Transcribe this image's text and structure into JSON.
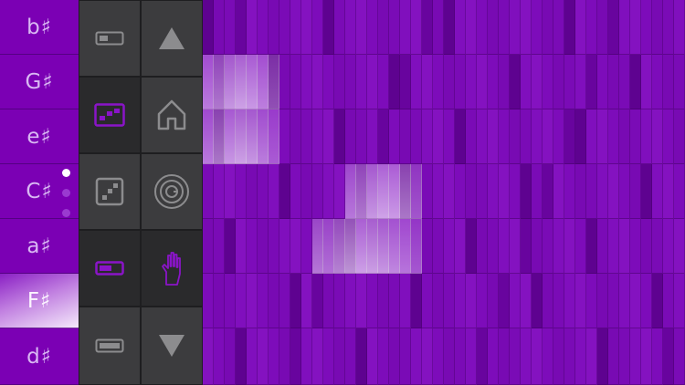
{
  "keyboard": {
    "keys": [
      {
        "label": "b♯"
      },
      {
        "label": "G♯"
      },
      {
        "label": "e♯"
      },
      {
        "label": "C♯"
      },
      {
        "label": "a♯"
      },
      {
        "label": "F♯"
      },
      {
        "label": "d♯"
      }
    ],
    "active_key": "F♯"
  },
  "toolbar": {
    "buttons": [
      {
        "name": "mode-bar-button",
        "icon": "slider-bar-icon"
      },
      {
        "name": "scroll-up-button",
        "icon": "triangle-up-icon"
      },
      {
        "name": "pattern-edit-button",
        "icon": "pattern-edit-icon"
      },
      {
        "name": "home-button",
        "icon": "home-icon"
      },
      {
        "name": "randomize-button",
        "icon": "dice-icon"
      },
      {
        "name": "spiral-button",
        "icon": "spiral-icon"
      },
      {
        "name": "mode-toggle-button",
        "icon": "toggle-bar-icon"
      },
      {
        "name": "hand-button",
        "icon": "hand-icon"
      },
      {
        "name": "mode-full-bar-button",
        "icon": "full-bar-icon"
      },
      {
        "name": "scroll-down-button",
        "icon": "triangle-down-icon"
      }
    ]
  },
  "sequencer": {
    "rows": 7,
    "columns": 44,
    "notes": [
      {
        "row": 1,
        "col": 0,
        "length": 7
      },
      {
        "row": 2,
        "col": 0,
        "length": 7
      },
      {
        "row": 3,
        "col": 13,
        "length": 7
      },
      {
        "row": 4,
        "col": 10,
        "length": 10
      }
    ]
  },
  "colors": {
    "background": "#7c0cb8",
    "note_light": "#e8d0f6",
    "panel": "#3c3c3e",
    "icon": "#8c8c8e",
    "icon_active": "#8a14c8"
  }
}
